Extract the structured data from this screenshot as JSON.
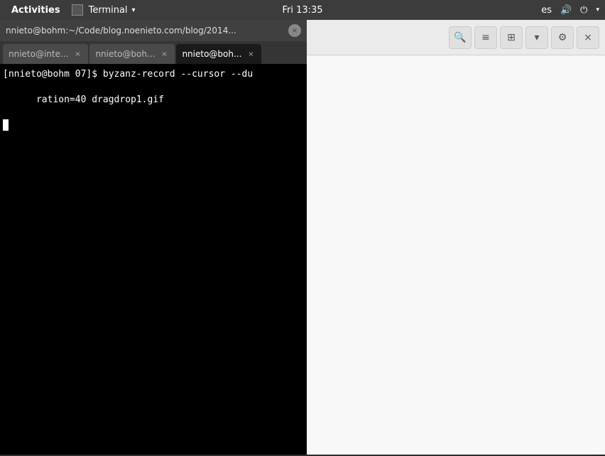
{
  "systembar": {
    "activities_label": "Activities",
    "terminal_menu_label": "Terminal",
    "datetime": "Fri 13:35",
    "language": "es",
    "volume_icon": "🔊",
    "power_icon": "⏻"
  },
  "terminal_window": {
    "title": "nnieto@bohm:~/Code/blog.noenieto.com/blog/2014...",
    "close_icon": "×",
    "tabs": [
      {
        "label": "nnieto@inte...",
        "active": false
      },
      {
        "label": "nnieto@boh...",
        "active": false
      },
      {
        "label": "nnieto@boh...",
        "active": true
      }
    ],
    "content_line1": "[nnieto@bohm 07]$ byzanz-record --cursor --du",
    "content_line2": "ration=40 dragdrop1.gif"
  },
  "toolbar": {
    "search_icon": "🔍",
    "menu_icon": "≡",
    "grid_icon": "⊞",
    "chevron_icon": "▾",
    "settings_icon": "⚙",
    "close_icon": "×"
  }
}
